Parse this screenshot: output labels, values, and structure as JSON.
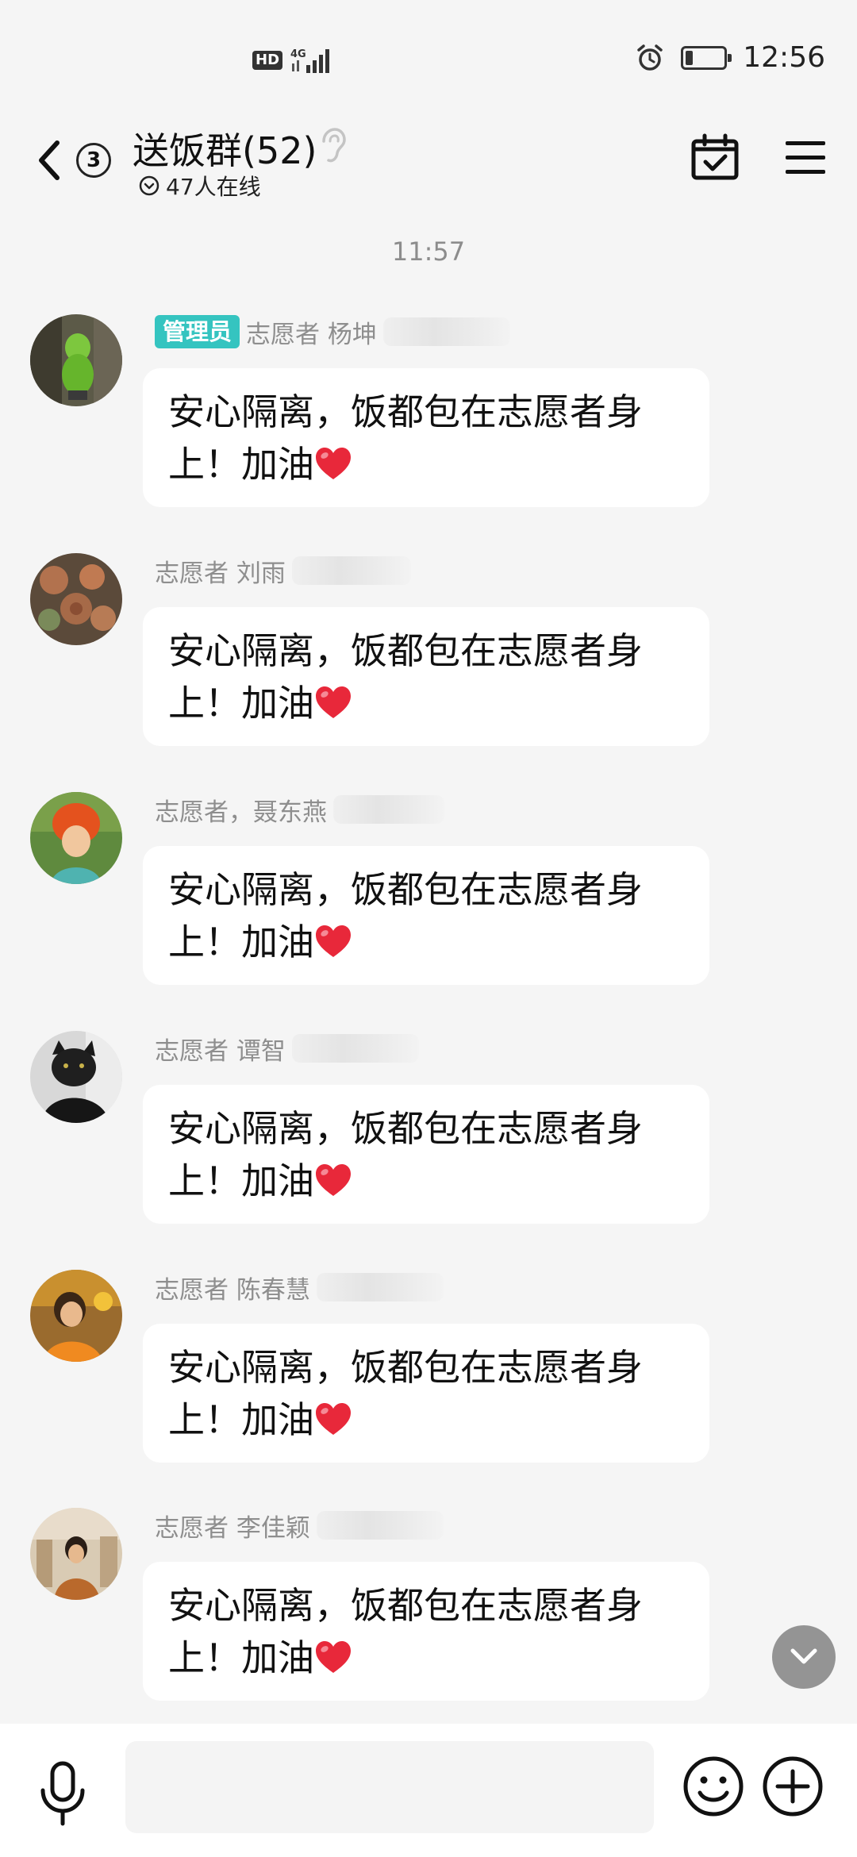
{
  "status_bar": {
    "network_badge": "HD",
    "network_type": "4G",
    "time": "12:56",
    "battery_percent": 20
  },
  "header": {
    "unread_count": "3",
    "group_name": "送饭群(52)",
    "online_text": "47人在线"
  },
  "chat": {
    "timestamp": "11:57",
    "messages": [
      {
        "badge": "管理员",
        "sender": "志愿者 杨坤",
        "text_line1": "安心隔离，饭都包在志愿者身",
        "text_line2": "上！加油"
      },
      {
        "sender": "志愿者 刘雨",
        "text_line1": "安心隔离，饭都包在志愿者身",
        "text_line2": "上！加油"
      },
      {
        "sender": "志愿者，聂东燕",
        "text_line1": "安心隔离，饭都包在志愿者身",
        "text_line2": "上！加油"
      },
      {
        "sender": "志愿者 谭智",
        "text_line1": "安心隔离，饭都包在志愿者身",
        "text_line2": "上！加油"
      },
      {
        "sender": "志愿者 陈春慧",
        "text_line1": "安心隔离，饭都包在志愿者身",
        "text_line2": "上！加油"
      },
      {
        "sender": "志愿者 李佳颖",
        "text_line1": "安心隔离，饭都包在志愿者身",
        "text_line2": "上！加油"
      }
    ]
  },
  "input": {
    "placeholder": ""
  },
  "icons": {
    "back": "chevron-left-icon",
    "ear": "ear-icon",
    "online": "chevron-down-circle-icon",
    "calendar": "calendar-check-icon",
    "menu": "hamburger-menu-icon",
    "heart": "red-heart-emoji",
    "scroll": "chevron-down-icon",
    "mic": "microphone-icon",
    "emoji": "smiley-icon",
    "plus": "plus-circle-icon"
  },
  "colors": {
    "background": "#f5f5f5",
    "bubble": "#ffffff",
    "admin_badge": "#35c4c0",
    "heart": "#e8283a",
    "muted_text": "#8e8e8e"
  }
}
